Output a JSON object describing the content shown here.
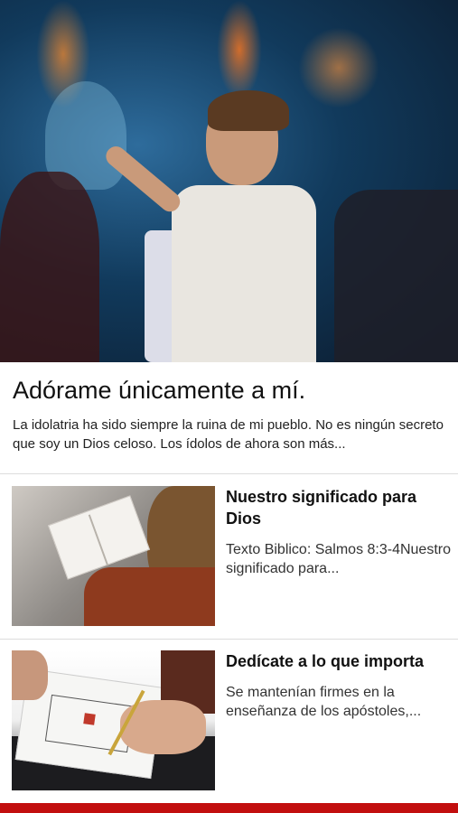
{
  "featured": {
    "title": "Adórame únicamente a mí.",
    "excerpt": "La idolatria ha sido siempre la ruina de mi pueblo. No es ningún secreto que soy un Dios celoso. Los ídolos de ahora son más..."
  },
  "articles": [
    {
      "title": "Nuestro significado para Dios",
      "excerpt": "Texto Biblico: Salmos 8:3-4Nuestro significado para..."
    },
    {
      "title": "Dedícate a lo que importa",
      "excerpt": "Se mantenían firmes en la enseñanza de los apóstoles,..."
    }
  ],
  "colors": {
    "accent": "#c20e0e",
    "divider": "#dddddd"
  }
}
